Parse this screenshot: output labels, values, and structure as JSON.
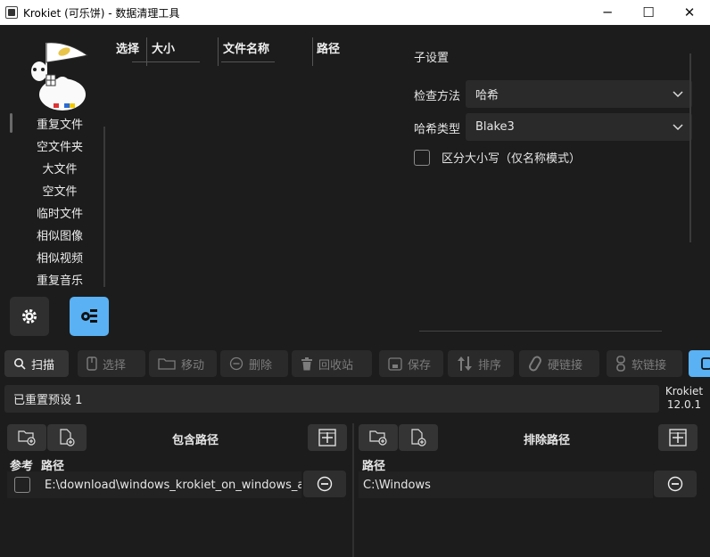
{
  "window": {
    "title": "Krokiet (可乐饼) - 数据清理工具",
    "minimize": "─",
    "maximize": "☐",
    "close": "✕"
  },
  "sidebar": {
    "tools": [
      "重复文件",
      "空文件夹",
      "大文件",
      "空文件",
      "临时文件",
      "相似图像",
      "相似视频",
      "重复音乐"
    ],
    "settings_icon": "gear-icon",
    "subsettings_icon": "subsettings-icon"
  },
  "results": {
    "columns": [
      "选择",
      "大小",
      "文件名称",
      "路径"
    ]
  },
  "subsettings": {
    "title": "子设置",
    "check_method_label": "检查方法",
    "check_method_value": "哈希",
    "hash_type_label": "哈希类型",
    "hash_type_value": "Blake3",
    "case_sensitive_label": "区分大小写（仅名称模式）",
    "case_sensitive_checked": false
  },
  "toolbar": {
    "scan": "扫描",
    "select": "选择",
    "move": "移动",
    "delete": "删除",
    "trash": "回收站",
    "save": "保存",
    "sort": "排序",
    "hardlink": "硬链接",
    "symlink": "软链接"
  },
  "status": {
    "message": "已重置预设 1",
    "app_name": "Krokiet",
    "version": "12.0.1"
  },
  "included": {
    "title": "包含路径",
    "col_ref": "参考",
    "col_path": "路径",
    "rows": [
      {
        "path": "E:\\download\\windows_krokiet_on_windows_all_backends",
        "reference": false
      }
    ]
  },
  "excluded": {
    "title": "排除路径",
    "col_path": "路径",
    "rows": [
      {
        "path": "C:\\Windows"
      }
    ]
  },
  "colors": {
    "background": "#1c1c1c",
    "accent": "#5ab1f3",
    "field": "#2a2a2a"
  }
}
